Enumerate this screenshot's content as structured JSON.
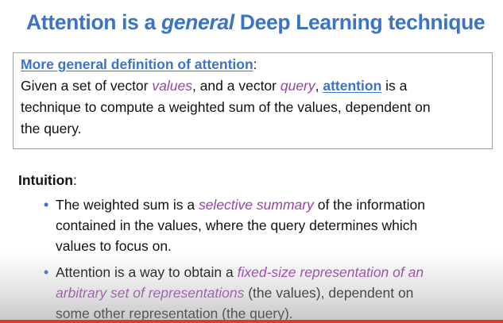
{
  "slide": {
    "title": {
      "part1": "Attention is a ",
      "emph": "general",
      "part2": " Deep Learning technique"
    },
    "definition": {
      "heading": "More general definition of attention",
      "heading_suffix": ":",
      "line1_a": "Given a set of vector ",
      "line1_values": "values",
      "line1_b": ", and a vector ",
      "line1_query": "query",
      "line1_c": ", ",
      "line1_attention": "attention",
      "line1_d": " is a",
      "line2": "technique to compute a weighted sum of the values, dependent on",
      "line3": "the query."
    },
    "intuition": {
      "label": "Intuition",
      "suffix": ":",
      "bullet_char": "•",
      "bullet1": {
        "l1_a": "The weighted sum is a ",
        "l1_emph": "selective summary",
        "l1_b": " of the information",
        "l2": "contained in the values, where the query determines which",
        "l3": "values to focus on."
      },
      "bullet2": {
        "l1_a": "Attention is a way to obtain a ",
        "l1_emph": "fixed-size representation of an",
        "l2_emph": "arbitrary set of representations",
        "l2_b": " (the values), dependent on",
        "l3": "some other representation (the query)."
      }
    },
    "colors": {
      "title_blue": "#3b74c4",
      "emphasis_purple": "#9b3fae",
      "bottom_bar_red": "#e03a2f"
    }
  }
}
